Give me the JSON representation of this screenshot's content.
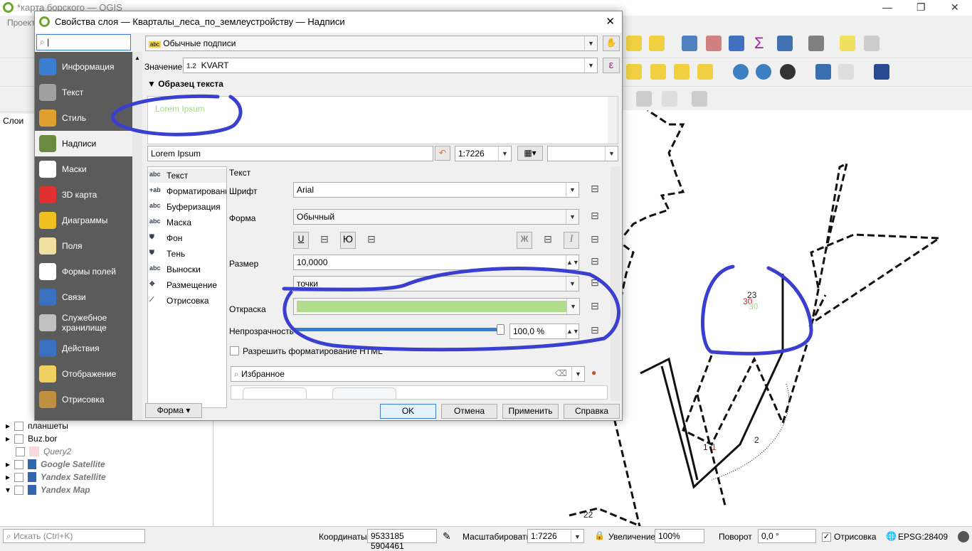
{
  "app": {
    "title": "*карта борского — QGIS",
    "menu_first": "Проект"
  },
  "layers_panel": {
    "header": "Слои",
    "items": [
      {
        "name": "планшеты",
        "checked": false,
        "italic": false
      },
      {
        "name": "Buz.bor",
        "checked": false,
        "italic": false
      },
      {
        "name": "Query2",
        "checked": false,
        "italic": true
      },
      {
        "name": "Google Satellite",
        "checked": false,
        "italic": true
      },
      {
        "name": "Yandex Satellite",
        "checked": false,
        "italic": true
      },
      {
        "name": "Yandex Map",
        "checked": false,
        "italic": true
      }
    ]
  },
  "map": {
    "labels": [
      "23",
      "30",
      "30",
      "1",
      "1",
      "2",
      "22"
    ],
    "label_color_red": "#e02020",
    "label_color_green": "#a8d88a",
    "annotation_color": "#3a3fcf"
  },
  "dialog": {
    "title": "Свойства слоя — Кварталы_леса_по_землеустройству — Надписи",
    "search_placeholder": "",
    "sidebar": [
      {
        "label": "Информация",
        "icon": "info-icon",
        "color": "#3b7fd0"
      },
      {
        "label": "Текст",
        "icon": "wrench-icon",
        "color": "#a0a0a0"
      },
      {
        "label": "Стиль",
        "icon": "paintbrush-icon",
        "color": "#e0a030"
      },
      {
        "label": "Надписи",
        "icon": "label-abc-icon",
        "color": "#6a8a40",
        "selected": true
      },
      {
        "label": "Маски",
        "icon": "mask-abc-icon",
        "color": "#ffffff"
      },
      {
        "label": "3D карта",
        "icon": "cube-icon",
        "color": "#e03030"
      },
      {
        "label": "Диаграммы",
        "icon": "diagram-icon",
        "color": "#f0c020"
      },
      {
        "label": "Поля",
        "icon": "fields-icon",
        "color": "#f0e0a0"
      },
      {
        "label": "Формы полей",
        "icon": "form-icon",
        "color": "#ffffff"
      },
      {
        "label": "Связи",
        "icon": "relations-icon",
        "color": "#3a70c0"
      },
      {
        "label": "Служебное хранилище",
        "icon": "database-icon",
        "color": "#c0c0c0"
      },
      {
        "label": "Действия",
        "icon": "actions-icon",
        "color": "#3a70c0"
      },
      {
        "label": "Отображение",
        "icon": "speech-icon",
        "color": "#f0d060"
      },
      {
        "label": "Отрисовка",
        "icon": "brush-icon",
        "color": "#c09040"
      }
    ],
    "mode": "Обычные подписи",
    "value_label": "Значение",
    "value_field": "KVART",
    "value_prefix": "1.2",
    "expr_btn": "ε",
    "sample_header": "Образец текста",
    "sample_text": "Lorem Ipsum",
    "sample_color": "#a8d88a",
    "sample_input": "Lorem Ipsum",
    "scale": "1:7226",
    "subtabs": [
      {
        "label": "Текст",
        "icon": "abc"
      },
      {
        "label": "Форматирование",
        "icon": "+ab"
      },
      {
        "label": "Буферизация",
        "icon": "abc"
      },
      {
        "label": "Маска",
        "icon": "abc"
      },
      {
        "label": "Фон",
        "icon": "shield"
      },
      {
        "label": "Тень",
        "icon": "shield"
      },
      {
        "label": "Выноски",
        "icon": "abc"
      },
      {
        "label": "Размещение",
        "icon": "arrows"
      },
      {
        "label": "Отрисовка",
        "icon": "brush"
      }
    ],
    "text": {
      "section": "Текст",
      "font_label": "Шрифт",
      "font": "Arial",
      "style_label": "Форма",
      "style": "Обычный",
      "underline": "U",
      "strike": "Ю",
      "bold": "Ж",
      "italic": "I",
      "size_label": "Размер",
      "size": "10,0000",
      "unit": "точки",
      "color_label": "Открaска",
      "color": "#b0dc8c",
      "opacity_label": "Непрозрачность",
      "opacity_value": "100,0 %",
      "opacity_percent": 100,
      "html_label": "Разрешить форматирование HTML",
      "html_checked": false,
      "favorites_placeholder": "Избранное"
    },
    "buttons": {
      "style": "Форма",
      "ok": "OK",
      "cancel": "Отмена",
      "apply": "Применить",
      "help": "Справка"
    }
  },
  "status": {
    "search_placeholder": "Искать (Ctrl+K)",
    "coords_label": "Координаты",
    "coords": "9533185 5904461",
    "scale_label": "Масштабировать",
    "scale": "1:7226",
    "magnifier_label": "Увеличение",
    "magnifier": "100%",
    "rotation_label": "Поворот",
    "rotation": "0,0 °",
    "render_label": "Отрисовка",
    "render_checked": true,
    "crs": "EPSG:28409"
  }
}
